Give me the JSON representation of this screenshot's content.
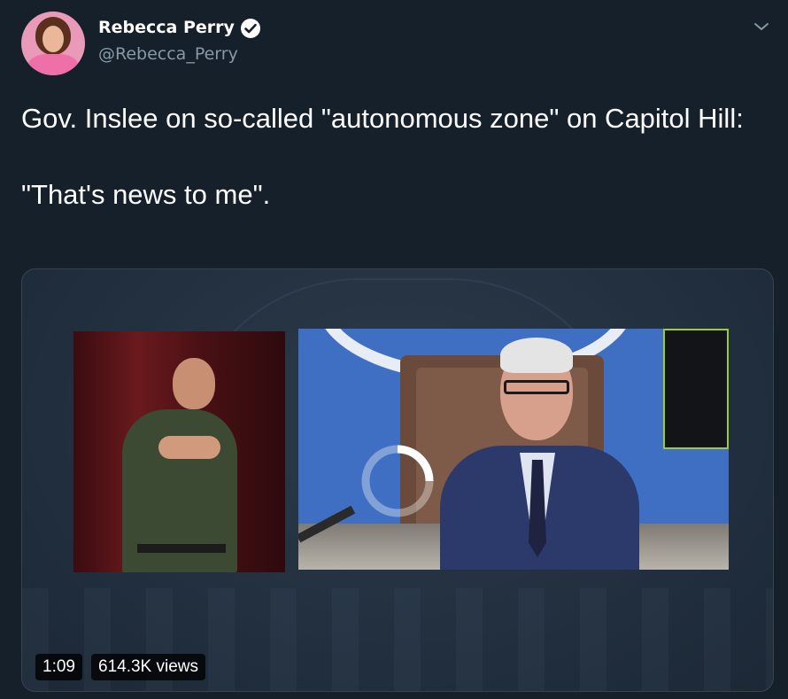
{
  "author": {
    "name": "Rebecca Perry",
    "handle": "@Rebecca_Perry",
    "verified_icon": "verified-badge-icon",
    "more_icon": "chevron-down-icon"
  },
  "tweet": {
    "line1": "Gov. Inslee on so-called \"autonomous zone\" on Capitol Hill:",
    "line2": "\"That's news to me\"."
  },
  "video": {
    "duration": "1:09",
    "views": "614.3K views",
    "loading_icon": "loading-spinner-icon"
  },
  "colors": {
    "background": "#15202b",
    "secondary_text": "#8899a6",
    "border": "#38444d"
  }
}
